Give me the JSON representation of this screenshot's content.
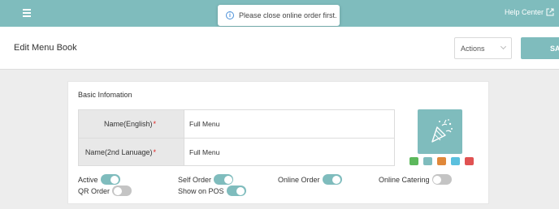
{
  "topbar": {
    "help_label": "Help Center"
  },
  "toast": {
    "message": "Please close online order first."
  },
  "header": {
    "title": "Edit Menu Book",
    "actions_label": "Actions",
    "save_label": "SA"
  },
  "basic_info": {
    "title": "Basic Infomation",
    "fields": [
      {
        "label": "Name(English)",
        "value": "Full Menu"
      },
      {
        "label": "Name(2nd Lanuage)",
        "value": "Full Menu"
      }
    ],
    "required_mark": "*"
  },
  "swatch_colors": [
    "#5cb85c",
    "#7fbcbd",
    "#e0883a",
    "#5bc0de",
    "#e05252"
  ],
  "image_color": "#7fbcbd",
  "toggles": [
    {
      "label": "Active",
      "on": true
    },
    {
      "label": "Self Order",
      "on": true
    },
    {
      "label": "Online Order",
      "on": true
    },
    {
      "label": "Online Catering",
      "on": false
    },
    {
      "label": "QR Order",
      "on": false
    },
    {
      "label": "Show on POS",
      "on": true
    }
  ]
}
